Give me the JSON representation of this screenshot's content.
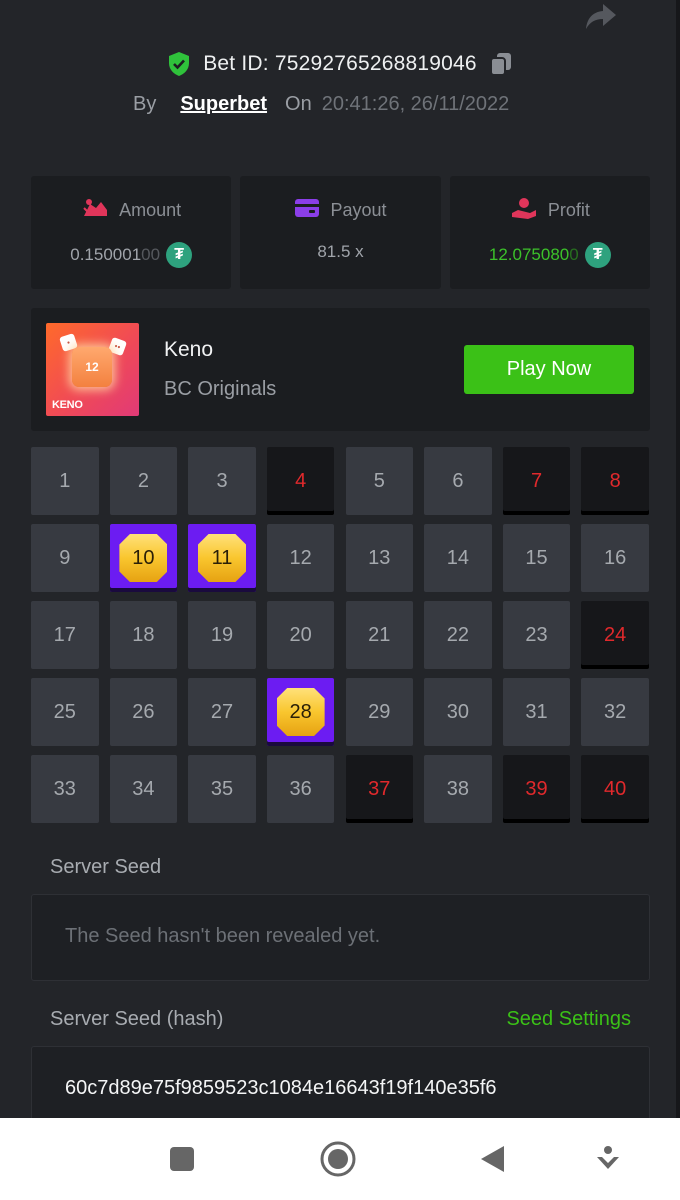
{
  "bet": {
    "id_text": "Bet ID: 75292765268819046",
    "by_label": "By",
    "provider": "Superbet",
    "on_label": "On",
    "timestamp": "20:41:26, 26/11/2022"
  },
  "stats": {
    "amount": {
      "label": "Amount",
      "value_main": "0.150001",
      "value_dim": "00"
    },
    "payout": {
      "label": "Payout",
      "value": "81.5 x"
    },
    "profit": {
      "label": "Profit",
      "value_main": "12.075080",
      "value_dim": "0"
    },
    "coin_symbol": "₮"
  },
  "game": {
    "name": "Keno",
    "provider": "BC Originals",
    "play_label": "Play Now",
    "thumb_number": "12",
    "thumb_label": "KENO"
  },
  "grid": {
    "numbers": [
      1,
      2,
      3,
      4,
      5,
      6,
      7,
      8,
      9,
      10,
      11,
      12,
      13,
      14,
      15,
      16,
      17,
      18,
      19,
      20,
      21,
      22,
      23,
      24,
      25,
      26,
      27,
      28,
      29,
      30,
      31,
      32,
      33,
      34,
      35,
      36,
      37,
      38,
      39,
      40
    ],
    "hits": [
      10,
      11,
      28
    ],
    "misses": [
      4,
      7,
      8,
      24,
      37,
      39,
      40
    ]
  },
  "server_seed": {
    "label": "Server Seed",
    "value": "The Seed hasn't been revealed yet."
  },
  "server_seed_hash": {
    "label": "Server Seed (hash)",
    "settings_link": "Seed Settings",
    "value": "60c7d89e75f9859523c1084e16643f19f140e35f6"
  },
  "colors": {
    "accent_green": "#3bc117",
    "hit_purple": "#6c1cf2",
    "miss_red": "#e0292c",
    "coin_teal": "#2ea27e"
  }
}
